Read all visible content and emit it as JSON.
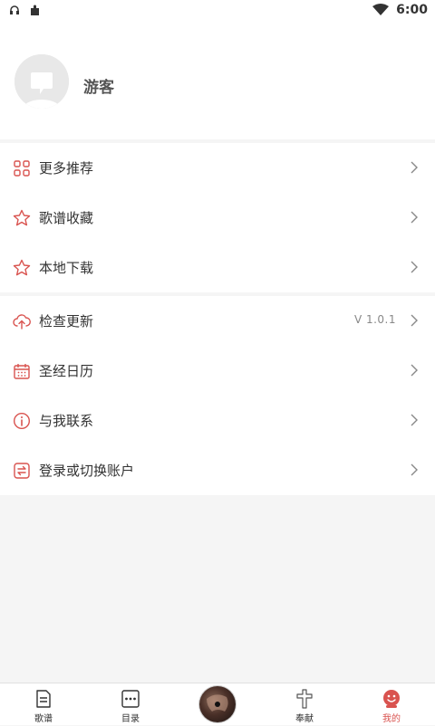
{
  "status_bar": {
    "time": "6:00"
  },
  "profile": {
    "username": "游客"
  },
  "section1": [
    {
      "label": "更多推荐",
      "icon": "grid-icon"
    },
    {
      "label": "歌谱收藏",
      "icon": "star-icon"
    },
    {
      "label": "本地下载",
      "icon": "star-icon"
    }
  ],
  "section2": [
    {
      "label": "检查更新",
      "icon": "cloud-upload-icon",
      "value": "V 1.0.1"
    },
    {
      "label": "圣经日历",
      "icon": "calendar-icon"
    },
    {
      "label": "与我联系",
      "icon": "info-icon"
    },
    {
      "label": "登录或切换账户",
      "icon": "switch-account-icon"
    }
  ],
  "bottom_nav": {
    "items": [
      {
        "label": "歌谱",
        "icon": "document-icon"
      },
      {
        "label": "目录",
        "icon": "menu-dots-icon"
      },
      {
        "label": "",
        "icon": "album-disc-icon"
      },
      {
        "label": "奉献",
        "icon": "cross-icon"
      },
      {
        "label": "我的",
        "icon": "mascot-icon",
        "active": true
      }
    ]
  },
  "colors": {
    "accent": "#d9534f",
    "text": "#333333",
    "background": "#f5f5f5"
  }
}
